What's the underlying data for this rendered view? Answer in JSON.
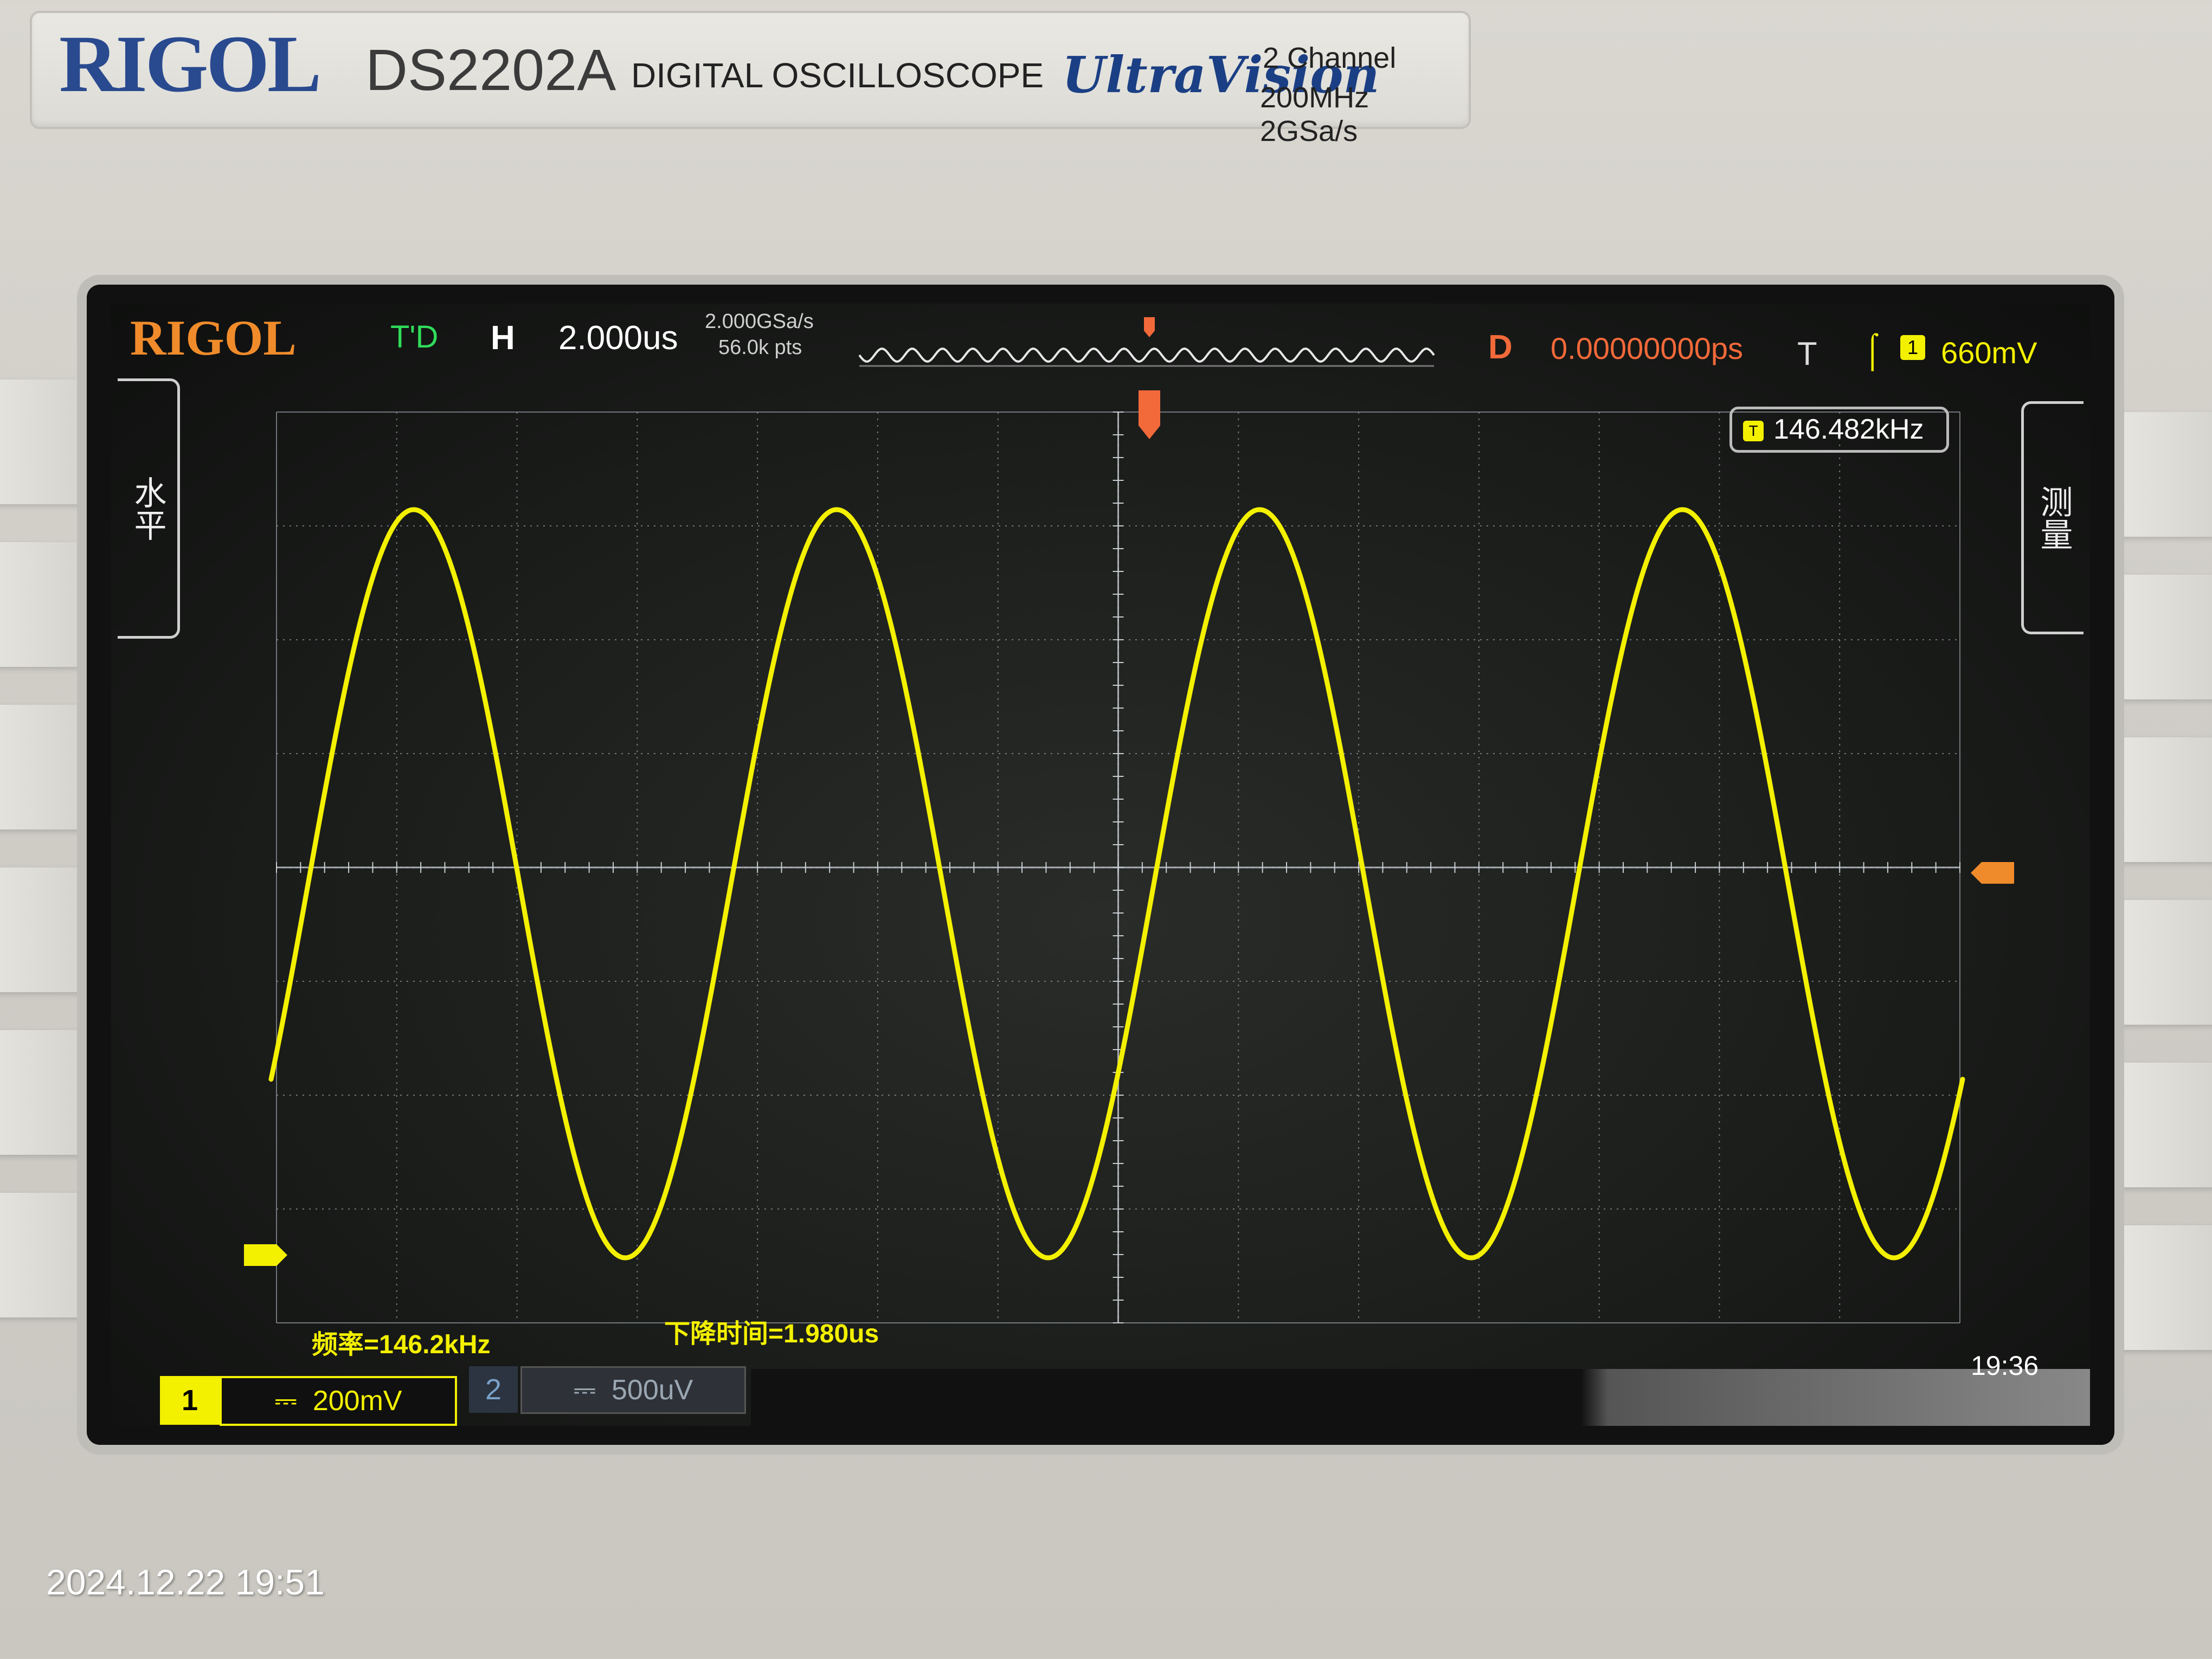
{
  "instrument": {
    "brand": "RIGOL",
    "model": "DS2202A",
    "description": "DIGITAL OSCILLOSCOPE",
    "series": "UltraVision",
    "channels": "2 Channel",
    "specs": "200MHz  2GSa/s"
  },
  "screen": {
    "brand": "RIGOL",
    "status": "T'D",
    "horizontal": {
      "label": "H",
      "timebase": "2.000us",
      "sample_rate": "2.000GSa/s",
      "memory_depth": "56.0k pts"
    },
    "delay": {
      "label": "D",
      "value": "0.00000000ps"
    },
    "trigger": {
      "label": "T",
      "edge_icon": "rising-edge-icon",
      "source": "1",
      "level": "660mV"
    },
    "side_left_label": "水平",
    "side_right_label": "测量",
    "frequency_counter": {
      "source": "T",
      "value": "146.482kHz"
    },
    "measurements": [
      "频率=146.2kHz",
      "下降时间=1.980us"
    ],
    "clock": "19:36",
    "ch1": {
      "number": "1",
      "coupling_icon": "dc-coupling-icon",
      "scale": "200mV",
      "marker": "1"
    },
    "ch2": {
      "number": "2",
      "coupling_icon": "dc-coupling-icon",
      "scale": "500uV"
    },
    "trigger_marker": "T",
    "colors": {
      "trace": "#f3f000",
      "grid": "#9aa0a8",
      "brand": "#f08b2b",
      "delay": "#f2693a",
      "status": "#2fdc5a"
    }
  },
  "waveform": {
    "type": "sine",
    "frequency_khz": 146.482,
    "cycles_on_screen": 4
  },
  "photo_timestamp": "2024.12.22 19:51"
}
